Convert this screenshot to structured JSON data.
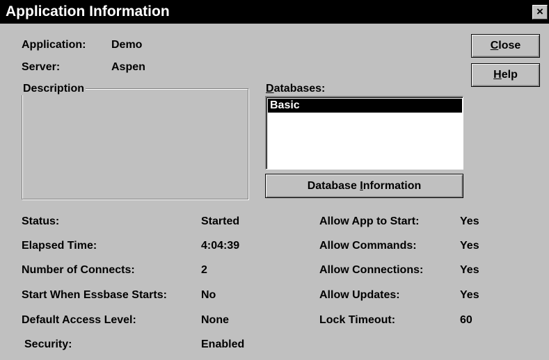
{
  "window": {
    "title": "Application Information",
    "close_glyph": "×"
  },
  "info": {
    "application_label": "Application:",
    "application_value": "Demo",
    "server_label": "Server:",
    "server_value": "Aspen"
  },
  "buttons": {
    "close_accel": "C",
    "close_rest": "lose",
    "help_accel": "H",
    "help_rest": "elp",
    "dbinfo_pre": "Database ",
    "dbinfo_accel": "I",
    "dbinfo_rest": "nformation"
  },
  "description": {
    "label": "Description"
  },
  "databases": {
    "label_accel": "D",
    "label_rest": "atabases:",
    "items": [
      "Basic"
    ],
    "selected": "Basic"
  },
  "left_stats": [
    {
      "label": "Status:",
      "value": "Started"
    },
    {
      "label": "Elapsed Time:",
      "value": "4:04:39"
    },
    {
      "label": "Number of Connects:",
      "value": "2"
    },
    {
      "label": "Start When Essbase Starts:",
      "value": "No"
    },
    {
      "label": "Default Access Level:",
      "value": "None"
    },
    {
      "label": "Security:",
      "value": "Enabled"
    }
  ],
  "right_stats": [
    {
      "label": "Allow App to Start:",
      "value": "Yes"
    },
    {
      "label": "Allow Commands:",
      "value": "Yes"
    },
    {
      "label": "Allow Connections:",
      "value": "Yes"
    },
    {
      "label": "Allow Updates:",
      "value": "Yes"
    },
    {
      "label": "Lock Timeout:",
      "value": "60"
    }
  ],
  "colors": {
    "face": "#c0c0c0",
    "titlebar": "#000000",
    "selection": "#000000"
  }
}
